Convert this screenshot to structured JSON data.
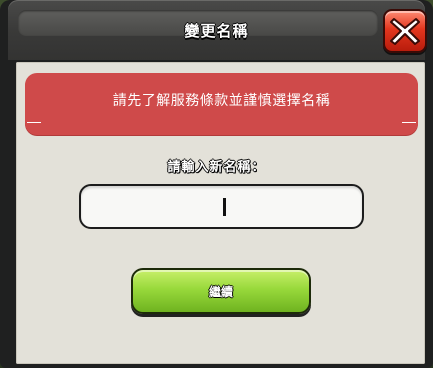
{
  "dialog": {
    "title": "變更名稱",
    "close_icon": "close-x-icon",
    "notice": "請先了解服務條款並謹慎選擇名稱",
    "prompt": "請輸入新名稱：",
    "name_input": {
      "value": "",
      "has_caret": true
    },
    "continue_label": "繼續"
  },
  "colors": {
    "notice_background": "#cf4a4a",
    "close_button": "#e3361e",
    "continue_button": "#98d93b",
    "panel_background": "#e3e1d9"
  }
}
